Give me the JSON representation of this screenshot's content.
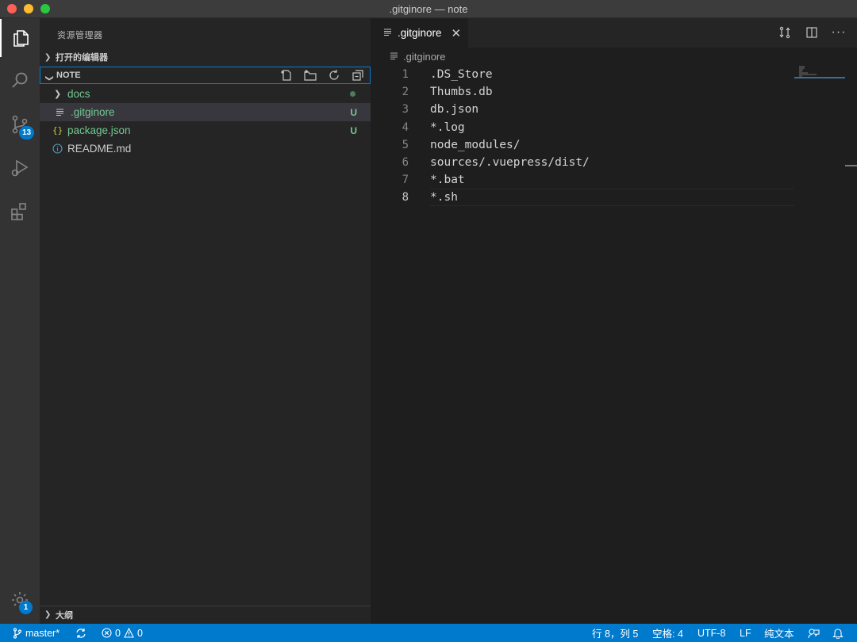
{
  "window": {
    "title": ".gitginore — note"
  },
  "activity": {
    "scm_badge": "13",
    "settings_badge": "1"
  },
  "sidebar": {
    "title": "资源管理器",
    "open_editors": "打开的编辑器",
    "folder": "NOTE",
    "outline": "大纲",
    "items": [
      {
        "label": "docs",
        "decoration": "dot"
      },
      {
        "label": ".gitginore",
        "decoration": "U"
      },
      {
        "label": "package.json",
        "decoration": "U"
      },
      {
        "label": "README.md",
        "decoration": ""
      }
    ]
  },
  "editor": {
    "tab_label": ".gitginore",
    "breadcrumb": ".gitginore",
    "lines": [
      {
        "n": "1",
        "text": ".DS_Store"
      },
      {
        "n": "2",
        "text": "Thumbs.db"
      },
      {
        "n": "3",
        "text": "db.json"
      },
      {
        "n": "4",
        "text": "*.log"
      },
      {
        "n": "5",
        "text": "node_modules/"
      },
      {
        "n": "6",
        "text": "sources/.vuepress/dist/"
      },
      {
        "n": "7",
        "text": "*.bat"
      },
      {
        "n": "8",
        "text": "*.sh"
      }
    ]
  },
  "status": {
    "branch": "master*",
    "errors": "0",
    "warnings": "0",
    "position": "行 8，列 5",
    "indent": "空格: 4",
    "encoding": "UTF-8",
    "eol": "LF",
    "language": "纯文本"
  },
  "colors": {
    "accent": "#007acc",
    "untracked": "#73c991",
    "sidebar_bg": "#252526",
    "editor_bg": "#1e1e1e"
  }
}
